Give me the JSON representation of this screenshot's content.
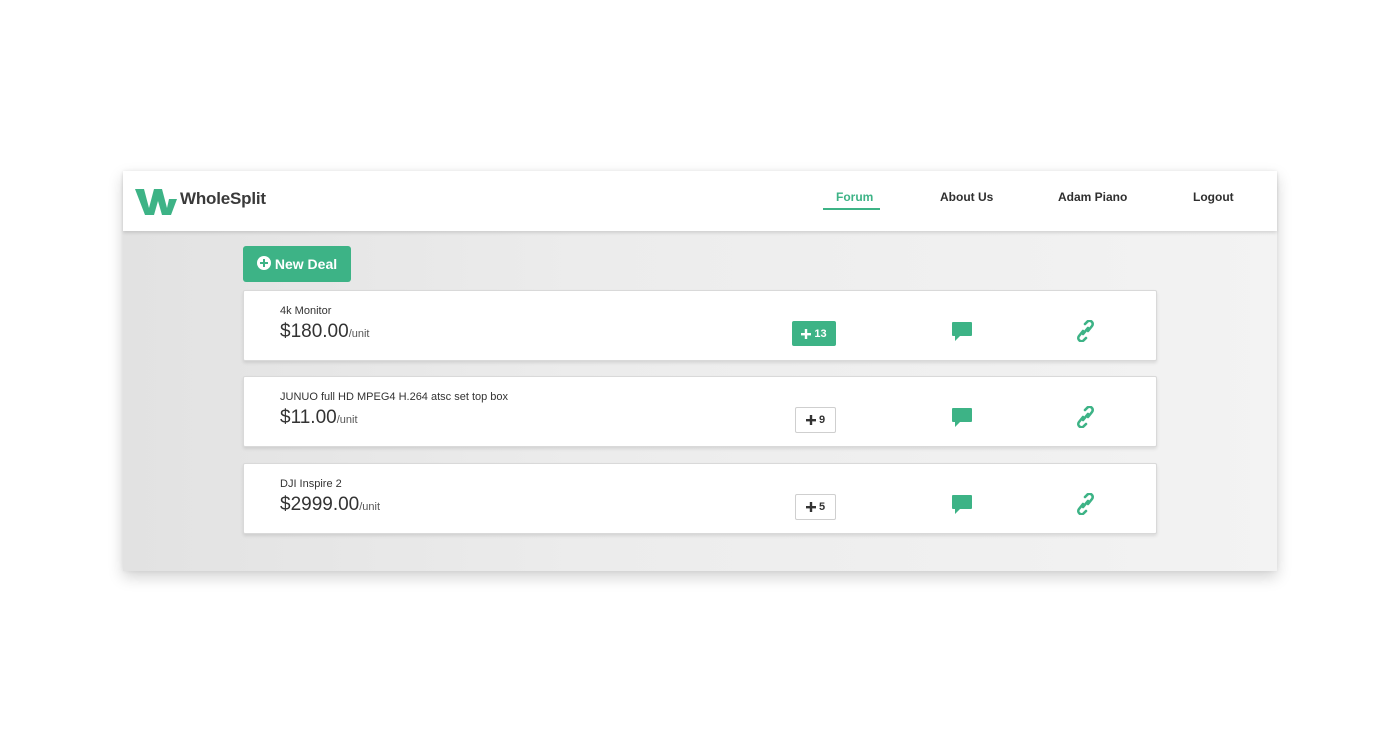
{
  "brand": {
    "name": "WholeSplit",
    "logo_icon": "w-logo-icon",
    "accent": "#3db386"
  },
  "nav": [
    {
      "label": "Forum",
      "active": true
    },
    {
      "label": "About Us",
      "active": false
    },
    {
      "label": "Adam Piano",
      "active": false
    },
    {
      "label": "Logout",
      "active": false
    }
  ],
  "toolbar": {
    "new_deal_label": "New Deal",
    "new_deal_icon": "plus-circle-icon"
  },
  "deals": [
    {
      "name": "4k Monitor",
      "price": "$180.00",
      "unit": "/unit",
      "count": "13",
      "joined": true
    },
    {
      "name": "JUNUO full HD MPEG4 H.264 atsc set top box",
      "price": "$11.00",
      "unit": "/unit",
      "count": "9",
      "joined": false
    },
    {
      "name": "DJI Inspire 2",
      "price": "$2999.00",
      "unit": "/unit",
      "count": "5",
      "joined": false
    }
  ],
  "icons": {
    "join": "plus-icon",
    "comment": "comment-icon",
    "share": "link-icon"
  }
}
